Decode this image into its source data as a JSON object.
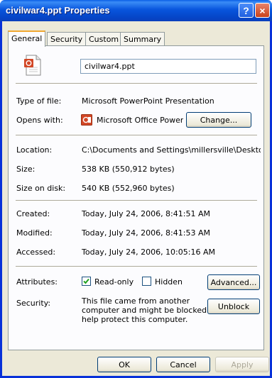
{
  "window": {
    "title": "civilwar4.ppt Properties",
    "help_glyph": "?",
    "close_glyph": "×"
  },
  "tabs": [
    {
      "label": "General",
      "active": true
    },
    {
      "label": "Security",
      "active": false
    },
    {
      "label": "Custom",
      "active": false
    },
    {
      "label": "Summary",
      "active": false
    }
  ],
  "general": {
    "file_name": "civilwar4.ppt",
    "type_label": "Type of file:",
    "type_value": "Microsoft PowerPoint Presentation",
    "opens_label": "Opens with:",
    "opens_value": "Microsoft Office Power",
    "change_button": "Change...",
    "location_label": "Location:",
    "location_value": "C:\\Documents and Settings\\millersville\\Desktop\\wo",
    "size_label": "Size:",
    "size_value": "538 KB (550,912 bytes)",
    "size_disk_label": "Size on disk:",
    "size_disk_value": "540 KB (552,960 bytes)",
    "created_label": "Created:",
    "created_value": "Today, July 24, 2006, 8:41:51 AM",
    "modified_label": "Modified:",
    "modified_value": "Today, July 24, 2006, 8:41:53 AM",
    "accessed_label": "Accessed:",
    "accessed_value": "Today, July 24, 2006, 10:05:16 AM",
    "attributes_label": "Attributes:",
    "readonly_label": "Read-only",
    "readonly_checked": true,
    "hidden_label": "Hidden",
    "hidden_checked": false,
    "advanced_button": "Advanced...",
    "security_label": "Security:",
    "security_text_1": "This file came from another",
    "security_text_2": "computer and might be blocked to",
    "security_text_3": "help protect this computer.",
    "unblock_button": "Unblock"
  },
  "footer": {
    "ok": "OK",
    "cancel": "Cancel",
    "apply": "Apply"
  },
  "colors": {
    "titlebar": "#0855dd",
    "window_border": "#0831d9",
    "tab_highlight": "#f1a832",
    "dialog_bg": "#ece9d8"
  },
  "icons": {
    "file": "powerpoint-file-icon",
    "app": "powerpoint-app-icon",
    "help": "help-icon",
    "close": "close-icon"
  }
}
